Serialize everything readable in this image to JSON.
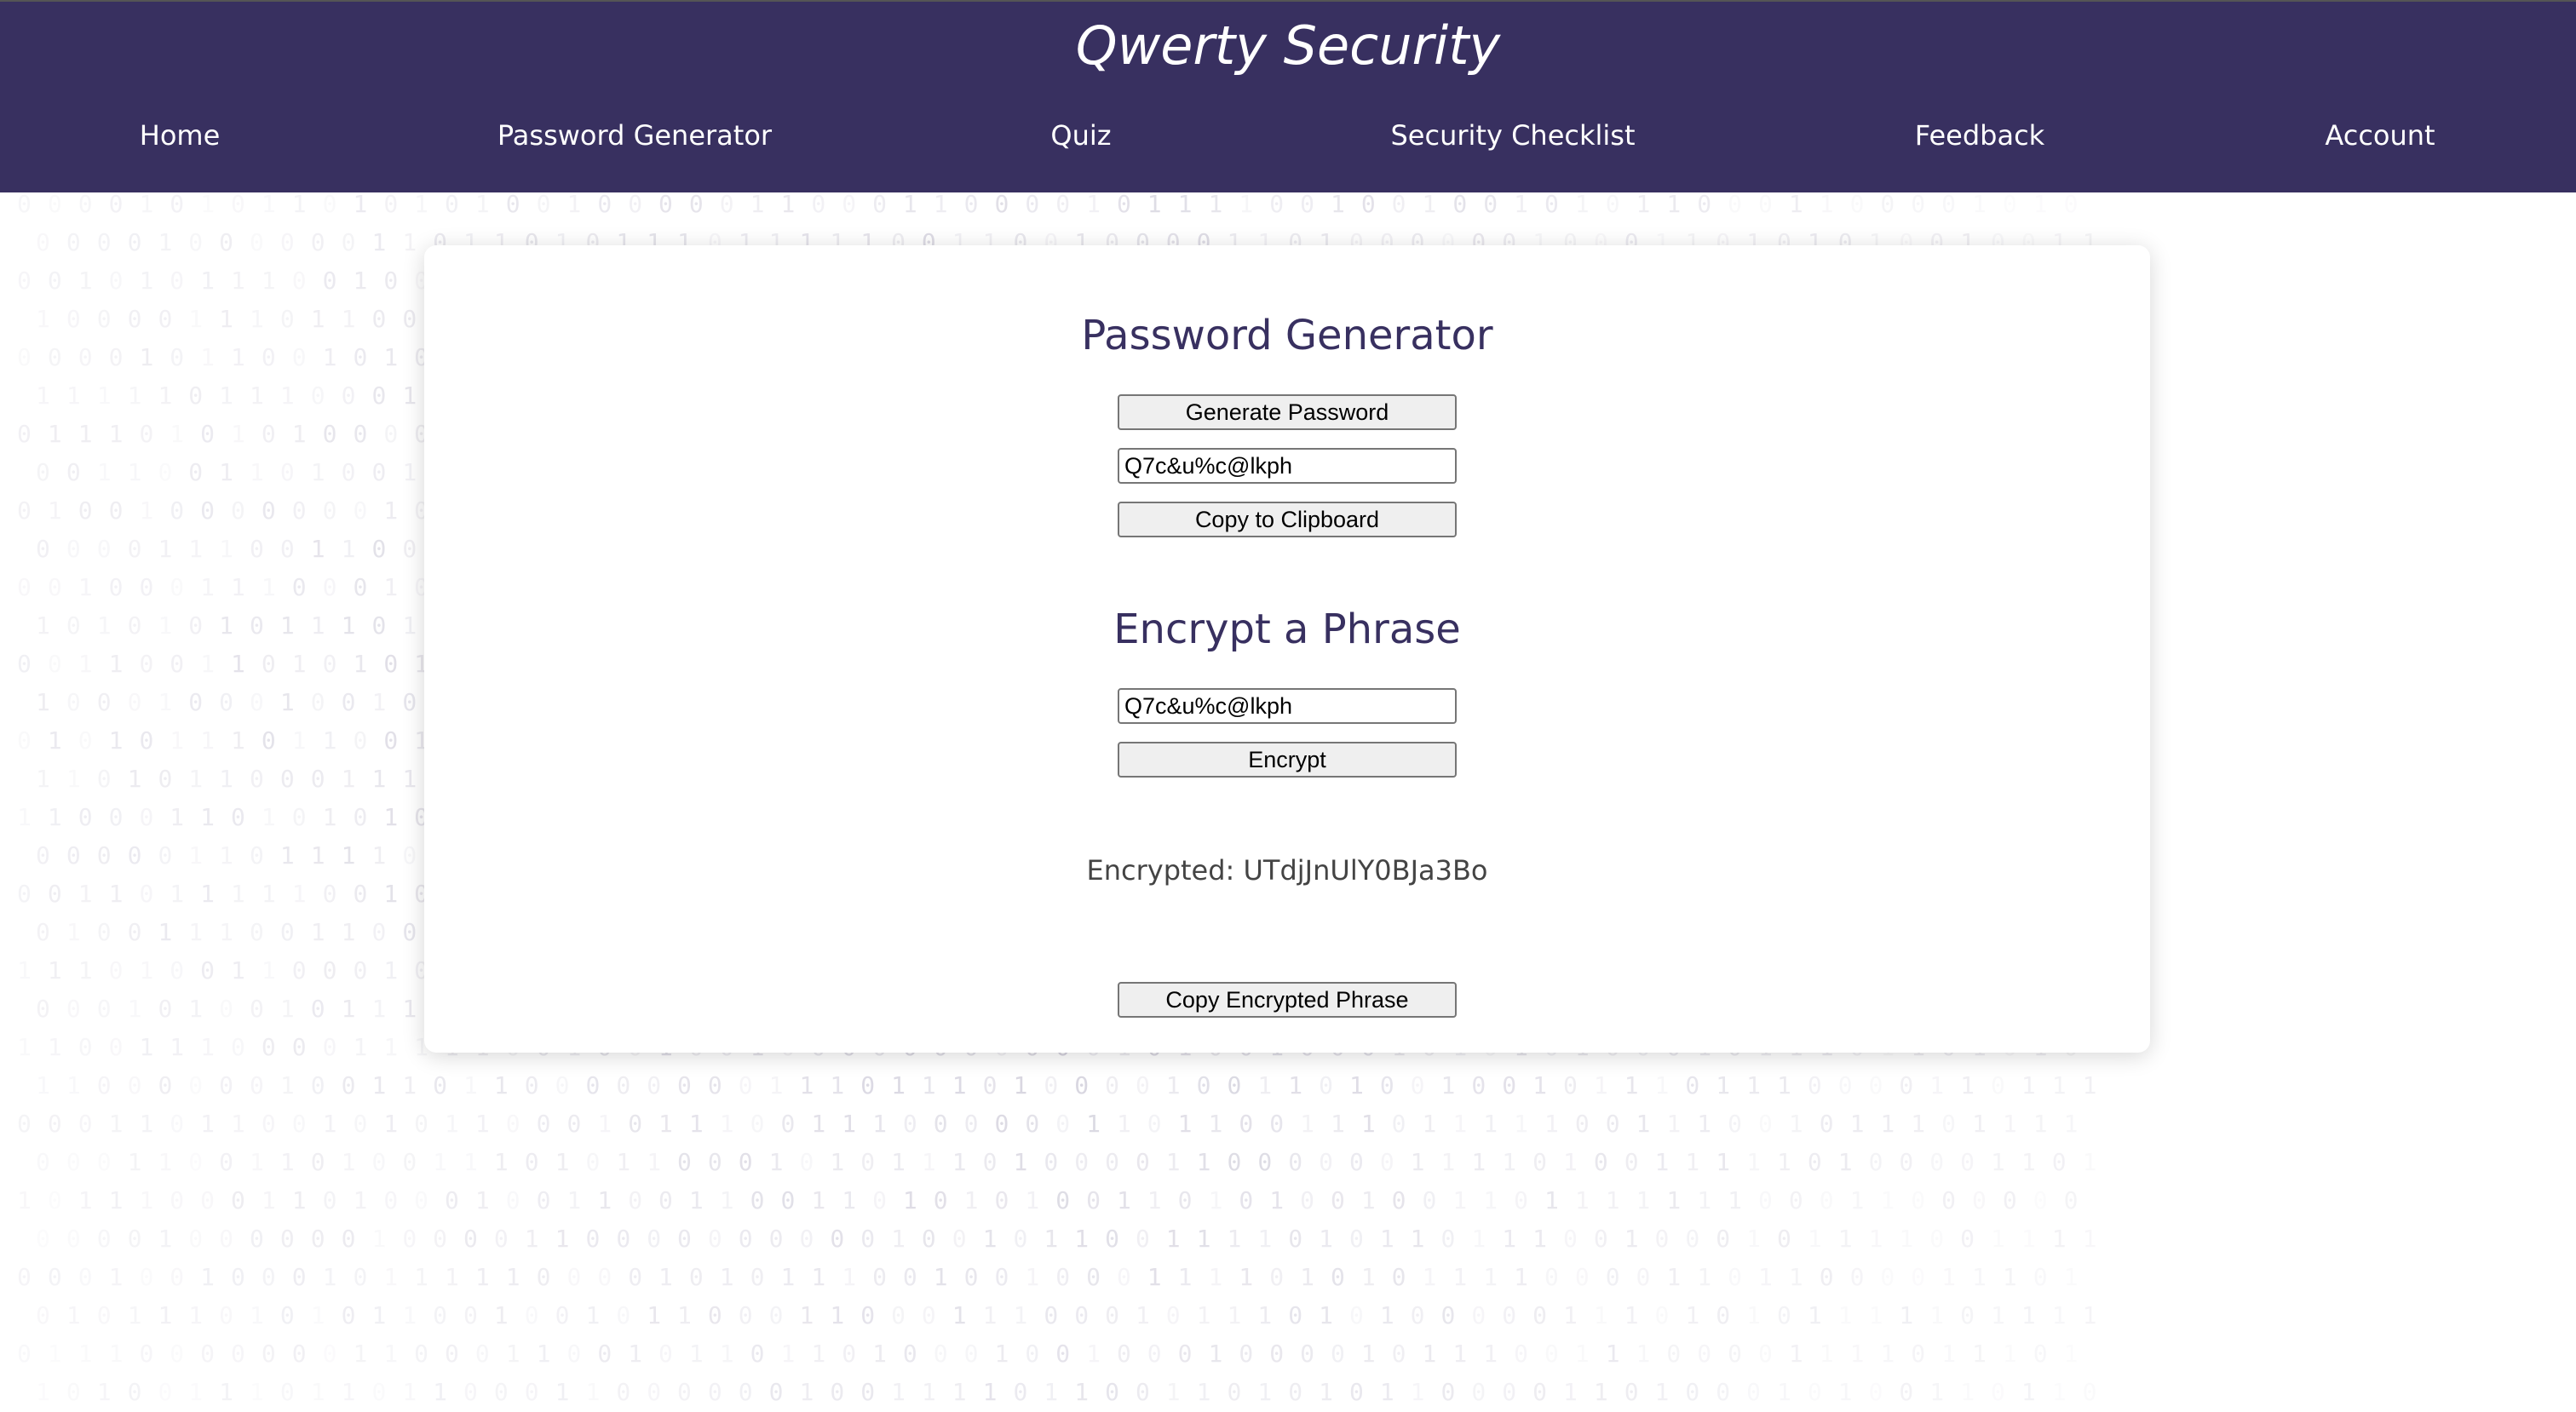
{
  "site": {
    "title": "Qwerty Security"
  },
  "nav": {
    "items": [
      {
        "label": "Home"
      },
      {
        "label": "Password Generator"
      },
      {
        "label": "Quiz"
      },
      {
        "label": "Security Checklist"
      },
      {
        "label": "Feedback"
      },
      {
        "label": "Account"
      }
    ]
  },
  "generator": {
    "heading": "Password Generator",
    "generate_button": "Generate Password",
    "password_value": "Q7c&u%c@lkph",
    "copy_button": "Copy to Clipboard"
  },
  "encrypt": {
    "heading": "Encrypt a Phrase",
    "phrase_value": "Q7c&u%c@lkph",
    "encrypt_button": "Encrypt",
    "result_label": "Encrypted:",
    "result_value": "UTdjJnUlY0BJa3Bo",
    "copy_button": "Copy Encrypted Phrase"
  },
  "colors": {
    "header_bg": "#383060",
    "heading_text": "#383060",
    "background_pattern": "#ece9f0"
  }
}
